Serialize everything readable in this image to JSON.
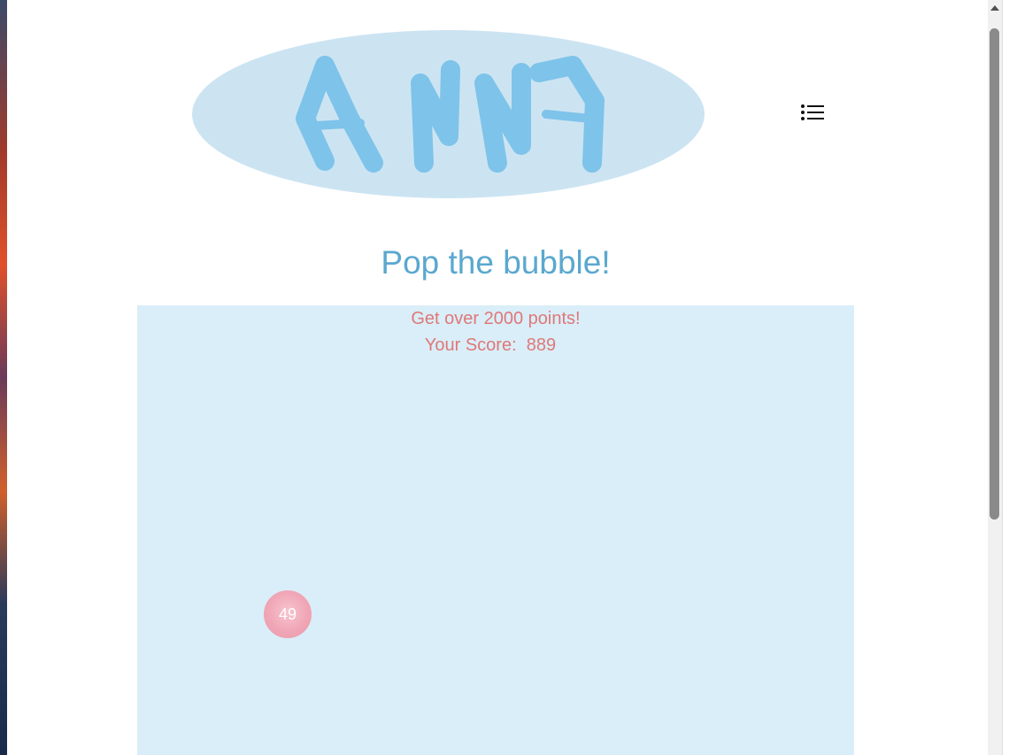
{
  "logo": {
    "text": "ANNA",
    "ellipse_color": "#cce4f2",
    "letter_color": "#7ec3ea"
  },
  "menu": {
    "icon": "list-menu-icon"
  },
  "page": {
    "title": "Pop the bubble!"
  },
  "game": {
    "goal": "Get over 2000 points!",
    "score_label": "Your Score:",
    "score_value": "889",
    "bubble_value": "49",
    "area_color": "#d9eef8",
    "text_color": "#e07878",
    "bubble_color": "#f0a6b6"
  }
}
